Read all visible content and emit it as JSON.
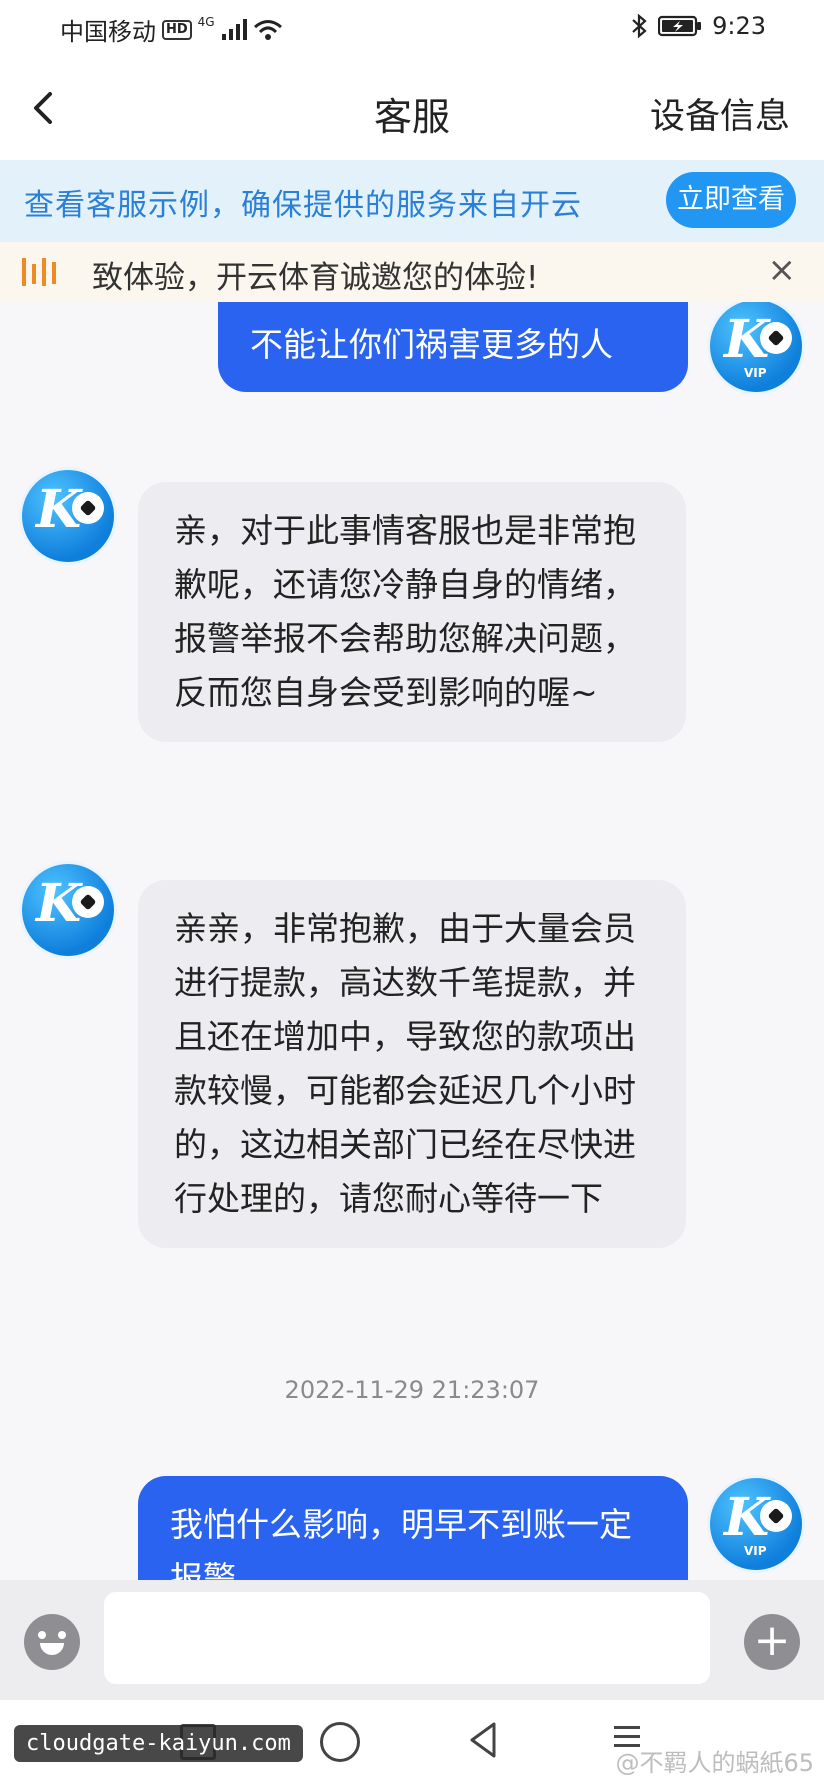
{
  "status_bar": {
    "carrier": "中国移动",
    "hd": "HD",
    "network": "4G",
    "time": "9:23"
  },
  "header": {
    "title": "客服",
    "right_label": "设备信息"
  },
  "tip_banner": {
    "text": "查看客服示例，确保提供的服务来自开云",
    "button": "立即查看"
  },
  "marquee": {
    "text": "致体验，开云体育诚邀您的体验!",
    "close": "×"
  },
  "messages": [
    {
      "side": "out",
      "text": "不能让你们祸害更多的人"
    },
    {
      "side": "in",
      "text": "亲，对于此事情客服也是非常抱歉呢，还请您冷静自身的情绪，报警举报不会帮助您解决问题，反而您自身会受到影响的喔~"
    },
    {
      "side": "in",
      "text": "亲亲，非常抱歉，由于大量会员进行提款，高达数千笔提款，并且还在增加中，导致您的款项出款较慢，可能都会延迟几个小时的，这边相关部门已经在尽快进行处理的，请您耐心等待一下"
    },
    {
      "side": "out",
      "text": "我怕什么影响，明早不到账一定报警"
    }
  ],
  "timestamp": "2022-11-29 21:23:07",
  "avatar": {
    "letter": "K",
    "vip": "VIP"
  },
  "input": {
    "plus": "+"
  },
  "watermark": {
    "left": "cloudgate-kaiyun.com",
    "right": "@不羁人的蜗紙65"
  }
}
